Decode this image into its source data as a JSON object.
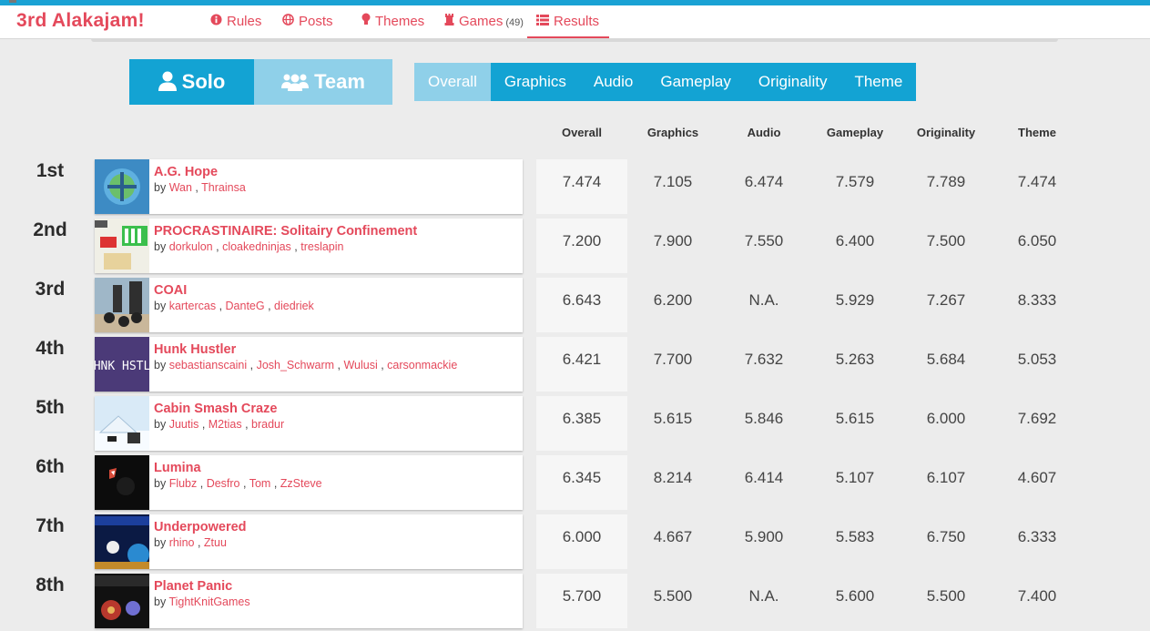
{
  "nav": {
    "brand": "3rd Alakajam!",
    "items": [
      {
        "label": "Rules",
        "icon": "info-icon"
      },
      {
        "label": "Posts",
        "icon": "globe-icon"
      },
      {
        "label": "Themes",
        "icon": "lightbulb-icon"
      },
      {
        "label": "Games",
        "icon": "rook-icon",
        "count": "(49)"
      },
      {
        "label": "Results",
        "icon": "list-icon"
      }
    ]
  },
  "division": {
    "solo": "Solo",
    "team": "Team",
    "active": "solo"
  },
  "categories": [
    "Overall",
    "Graphics",
    "Audio",
    "Gameplay",
    "Originality",
    "Theme"
  ],
  "active_category": "Overall",
  "columns": [
    "Overall",
    "Graphics",
    "Audio",
    "Gameplay",
    "Originality",
    "Theme"
  ],
  "colors": {
    "accent": "#e4495b",
    "blue": "#13a3d3",
    "light_blue": "#8fd0e9"
  },
  "authors_prefix": "by",
  "results": [
    {
      "rank": "1st",
      "title": "A.G. Hope",
      "authors": [
        "Wan",
        "Thrainsa"
      ],
      "scores": [
        "7.474",
        "7.105",
        "6.474",
        "7.579",
        "7.789",
        "7.474"
      ]
    },
    {
      "rank": "2nd",
      "title": "PROCRASTINAIRE: Solitairy Confinement",
      "authors": [
        "dorkulon",
        "cloakedninjas",
        "treslapin"
      ],
      "scores": [
        "7.200",
        "7.900",
        "7.550",
        "6.400",
        "7.500",
        "6.050"
      ]
    },
    {
      "rank": "3rd",
      "title": "COAI",
      "authors": [
        "kartercas",
        "DanteG",
        "diedriek"
      ],
      "scores": [
        "6.643",
        "6.200",
        "N.A.",
        "5.929",
        "7.267",
        "8.333"
      ]
    },
    {
      "rank": "4th",
      "title": "Hunk Hustler",
      "authors": [
        "sebastianscaini",
        "Josh_Schwarm",
        "Wulusi",
        "carsonmackie"
      ],
      "scores": [
        "6.421",
        "7.700",
        "7.632",
        "5.263",
        "5.684",
        "5.053"
      ]
    },
    {
      "rank": "5th",
      "title": "Cabin Smash Craze",
      "authors": [
        "Juutis",
        "M2tias",
        "bradur"
      ],
      "scores": [
        "6.385",
        "5.615",
        "5.846",
        "5.615",
        "6.000",
        "7.692"
      ]
    },
    {
      "rank": "6th",
      "title": "Lumina",
      "authors": [
        "Flubz",
        "Desfro",
        "Tom",
        "ZzSteve"
      ],
      "scores": [
        "6.345",
        "8.214",
        "6.414",
        "5.107",
        "6.107",
        "4.607"
      ]
    },
    {
      "rank": "7th",
      "title": "Underpowered",
      "authors": [
        "rhino",
        "Ztuu"
      ],
      "scores": [
        "6.000",
        "4.667",
        "5.900",
        "5.583",
        "6.750",
        "6.333"
      ]
    },
    {
      "rank": "8th",
      "title": "Planet Panic",
      "authors": [
        "TightKnitGames"
      ],
      "scores": [
        "5.700",
        "5.500",
        "N.A.",
        "5.600",
        "5.500",
        "7.400"
      ]
    }
  ]
}
